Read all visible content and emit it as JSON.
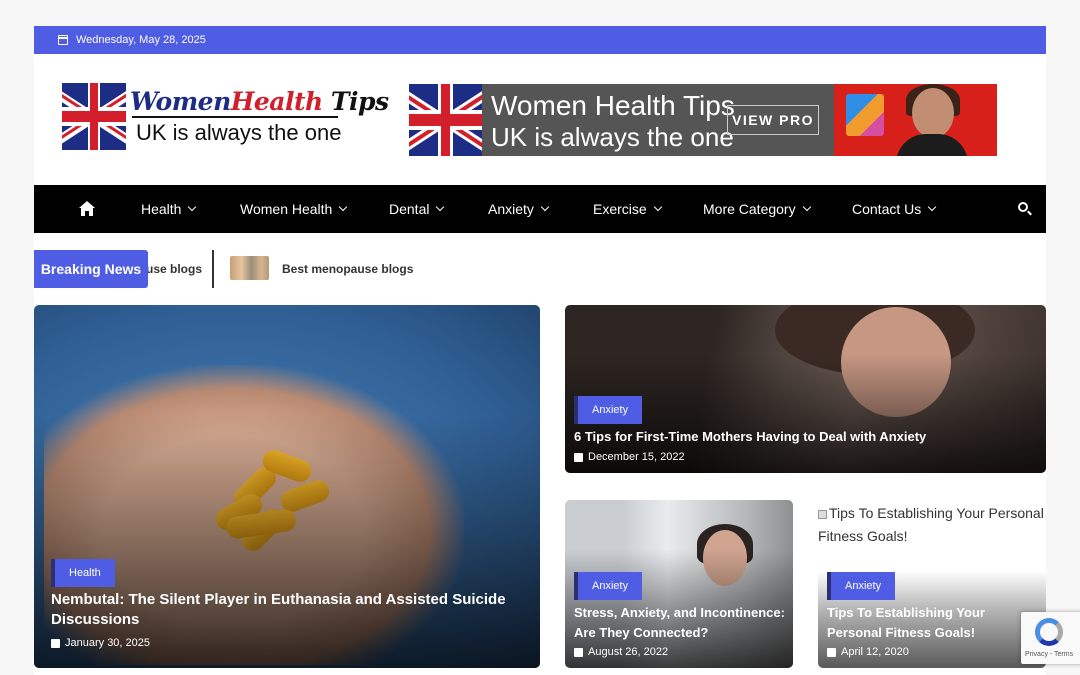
{
  "topbar": {
    "date": "Wednesday, May 28, 2025"
  },
  "logo": {
    "word1": "Women",
    "word2": "Health",
    "word3": "Tips",
    "tagline": "UK  is always the one"
  },
  "banner": {
    "line1": "Women Health Tips",
    "line2": "UK  is always the one",
    "button": "VIEW PRO"
  },
  "nav": {
    "items": [
      {
        "label": "Health"
      },
      {
        "label": "Women Health"
      },
      {
        "label": "Dental"
      },
      {
        "label": "Anxiety"
      },
      {
        "label": "Exercise"
      },
      {
        "label": "More Category"
      },
      {
        "label": "Contact Us"
      }
    ]
  },
  "breaking": {
    "label": "Breaking News",
    "ticker1": "use blogs",
    "ticker2": "Best menopause blogs"
  },
  "cards": {
    "main": {
      "category": "Health",
      "title": "Nembutal: The Silent Player in Euthanasia and Assisted Suicide Discussions",
      "date": "January 30, 2025"
    },
    "anx1": {
      "category": "Anxiety",
      "title": "6 Tips for First-Time Mothers Having to Deal with Anxiety",
      "date": "December 15, 2022"
    },
    "stress": {
      "category": "Anxiety",
      "title": "Stress, Anxiety, and Incontinence: Are They Connected?",
      "date": "August 26, 2022"
    },
    "fitness": {
      "category": "Anxiety",
      "alt": "Tips To Establishing Your Personal Fitness Goals!",
      "title": "Tips To Establishing Your Personal Fitness Goals!",
      "date": "April 12, 2020"
    }
  },
  "recaptcha": {
    "text": "Privacy - Terms"
  },
  "colors": {
    "accent": "#4f5de4",
    "nav_bg": "#000000",
    "flag_blue": "#1d2d85",
    "flag_red": "#d31f2b"
  }
}
